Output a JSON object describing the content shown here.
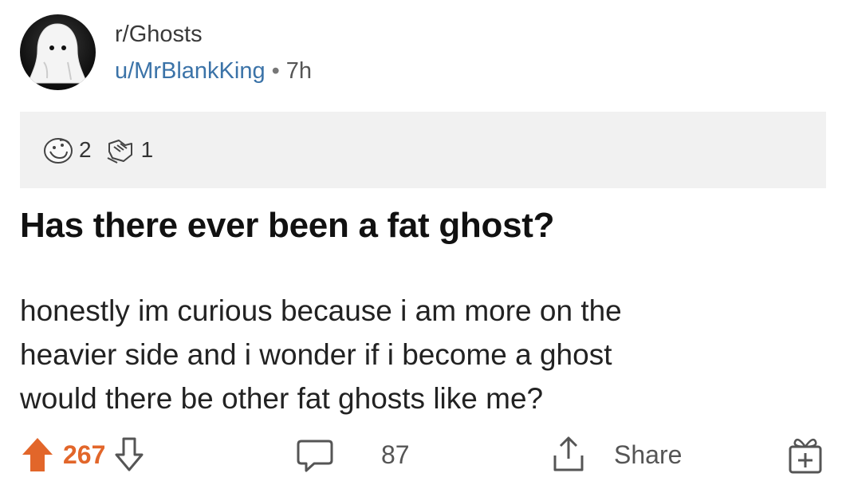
{
  "post": {
    "subreddit": "r/Ghosts",
    "author": "u/MrBlankKing",
    "separator": "•",
    "age": "7h",
    "title": "Has there ever been a fat ghost?",
    "body_lines": [
      "honestly im curious because i am more on the",
      "heavier side and i wonder if i become a ghost",
      "would there be other fat ghosts like me?"
    ]
  },
  "awards": [
    {
      "icon": "wholesome-award-icon",
      "count": "2"
    },
    {
      "icon": "handshake-award-icon",
      "count": "1"
    }
  ],
  "actions": {
    "upvote_icon": "upvote-arrow-icon",
    "vote_count": "267",
    "downvote_icon": "downvote-arrow-icon",
    "comment_icon": "comment-bubble-icon",
    "comment_count": "87",
    "share_icon": "share-upload-icon",
    "share_label": "Share",
    "gift_icon": "gift-award-icon"
  },
  "colors": {
    "upvote": "#e2662a",
    "username": "#3b73a8",
    "awards_bg": "#f1f1f1"
  }
}
